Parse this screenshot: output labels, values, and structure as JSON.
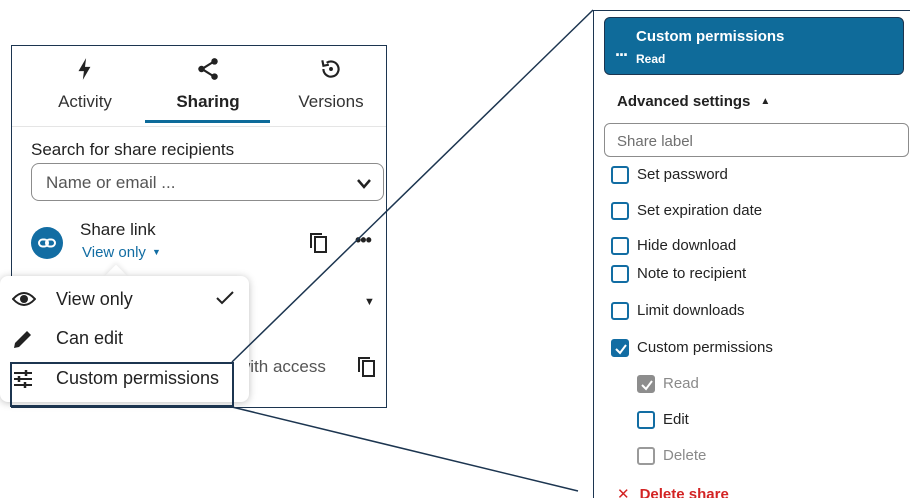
{
  "sidebar": {
    "tabs": [
      {
        "label": "Activity",
        "icon": "lightning-icon"
      },
      {
        "label": "Sharing",
        "icon": "share-icon",
        "active": true
      },
      {
        "label": "Versions",
        "icon": "history-icon"
      }
    ],
    "search": {
      "label": "Search for share recipients",
      "placeholder": "Name or email ..."
    },
    "share_link": {
      "title": "Share link",
      "permission": "View only"
    },
    "with_access_text": "with access",
    "permission_menu": [
      {
        "label": "View only",
        "icon": "eye-icon",
        "selected": true
      },
      {
        "label": "Can edit",
        "icon": "pencil-icon"
      },
      {
        "label": "Custom permissions",
        "icon": "tune-icon"
      }
    ]
  },
  "details": {
    "header": {
      "title": "Custom permissions",
      "subtitle": "Read",
      "menu": "..."
    },
    "advanced_settings": "Advanced settings",
    "share_label_placeholder": "Share label",
    "options": [
      {
        "label": "Set password",
        "checked": false
      },
      {
        "label": "Set expiration date",
        "checked": false
      },
      {
        "label": "Hide download",
        "checked": false
      },
      {
        "label": "Note to recipient",
        "checked": false
      },
      {
        "label": "Limit downloads",
        "checked": false
      },
      {
        "label": "Custom permissions",
        "checked": true
      }
    ],
    "permissions": [
      {
        "label": "Read",
        "checked": true,
        "disabled": true
      },
      {
        "label": "Edit",
        "checked": false,
        "disabled": false
      },
      {
        "label": "Delete",
        "checked": false,
        "disabled": true
      }
    ],
    "delete_share": "Delete share"
  },
  "colors": {
    "accent": "#126da3",
    "header_bg": "#0f6b9a",
    "outline": "#1c3550",
    "danger": "#d32424"
  }
}
